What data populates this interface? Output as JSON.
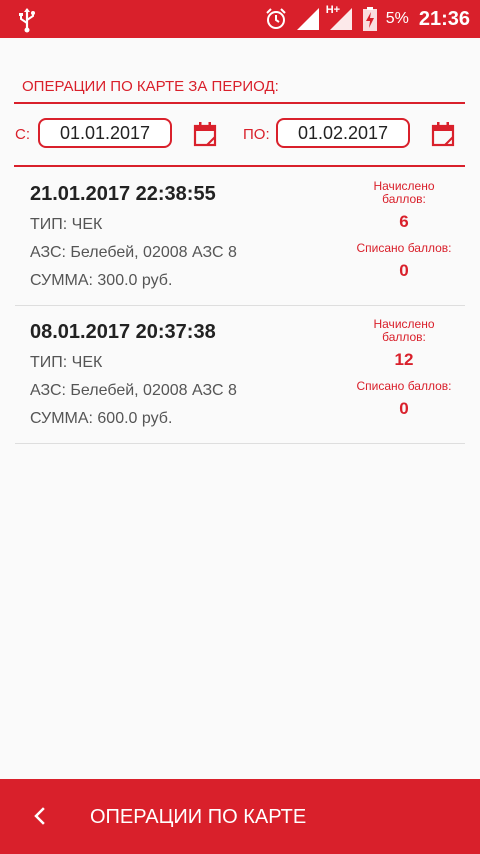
{
  "status_bar": {
    "battery_percent": "5%",
    "time": "21:36",
    "network_label": "H+",
    "icons": [
      "usb-icon",
      "alarm-icon",
      "signal-icon",
      "battery-charging-icon"
    ]
  },
  "filter": {
    "section_title": "ОПЕРАЦИИ ПО КАРТЕ ЗА ПЕРИОД:",
    "from_label": "С:",
    "from_date": "01.01.2017",
    "to_label": "ПО:",
    "to_date": "01.02.2017",
    "calendar_icon": "calendar-icon"
  },
  "operations": [
    {
      "datetime": "21.01.2017 22:38:55",
      "type": "ТИП: ЧЕК",
      "station": "АЗС: Белебей, 02008 АЗС 8",
      "amount": "СУММА: 300.0 руб.",
      "accrued_label": "Начислено баллов:",
      "accrued": "6",
      "debited_label": "Списано баллов:",
      "debited": "0"
    },
    {
      "datetime": "08.01.2017 20:37:38",
      "type": "ТИП: ЧЕК",
      "station": "АЗС: Белебей, 02008 АЗС 8",
      "amount": "СУММА: 600.0 руб.",
      "accrued_label": "Начислено баллов:",
      "accrued": "12",
      "debited_label": "Списано баллов:",
      "debited": "0"
    }
  ],
  "bottom_bar": {
    "title": "ОПЕРАЦИИ ПО КАРТЕ",
    "back_icon": "back-chevron-icon"
  },
  "colors": {
    "accent": "#d9202b",
    "background": "#fafafa"
  }
}
